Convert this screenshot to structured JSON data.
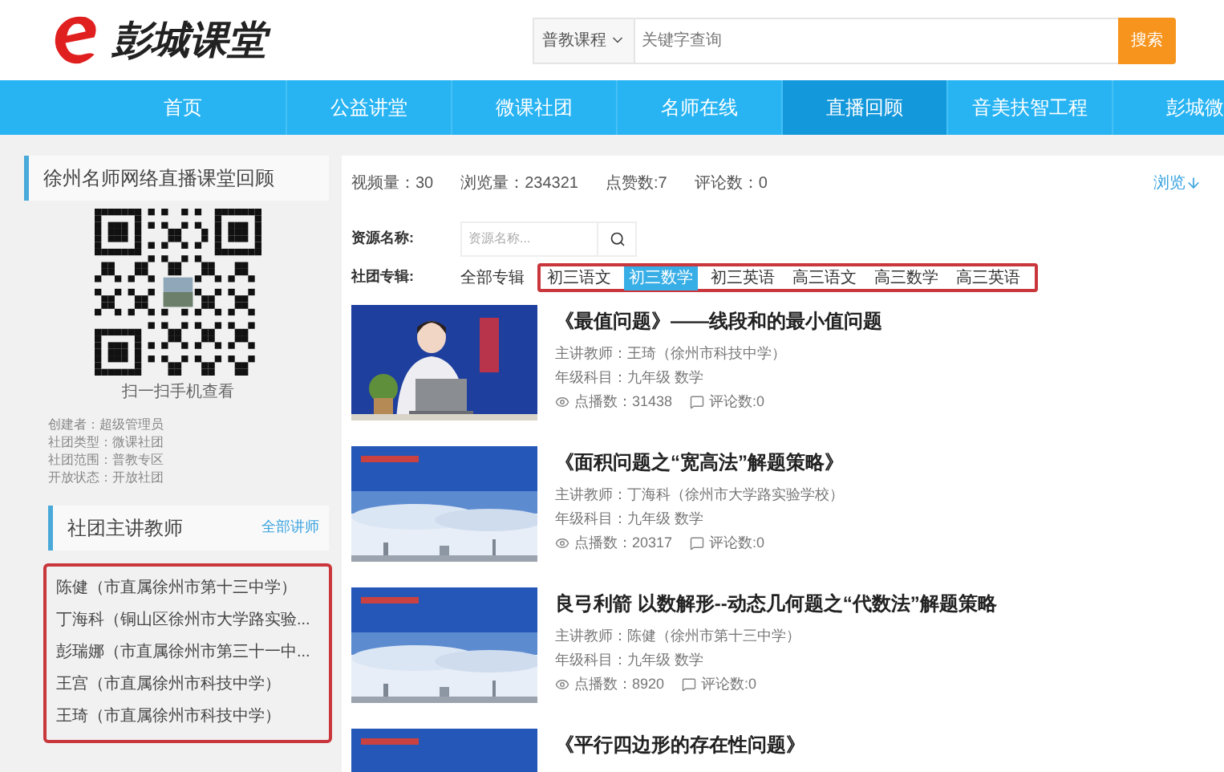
{
  "header": {
    "logo_text": "彭城课堂",
    "search": {
      "category": "普教课程",
      "placeholder": "关键字查询",
      "button": "搜索"
    }
  },
  "nav": [
    {
      "label": "首页",
      "selected": false
    },
    {
      "label": "公益讲堂",
      "selected": false
    },
    {
      "label": "微课社团",
      "selected": false
    },
    {
      "label": "名师在线",
      "selected": false
    },
    {
      "label": "直播回顾",
      "selected": true
    },
    {
      "label": "音美扶智工程",
      "selected": false
    },
    {
      "label": "彭城微",
      "selected": false
    }
  ],
  "sidebar": {
    "title": "徐州名师网络直播课堂回顾",
    "qr_caption": "扫一扫手机查看",
    "info": [
      "创建者：超级管理员",
      "社团类型：微课社团",
      "社团范围：普教专区",
      "开放状态：开放社团"
    ],
    "teachers_title": "社团主讲教师",
    "teachers_link": "全部讲师",
    "teachers": [
      "陈健（市直属徐州市第十三中学）",
      "丁海科（铜山区徐州市大学路实验...",
      "彭瑞娜（市直属徐州市第三十一中...",
      "王宫（市直属徐州市科技中学）",
      "王琦（市直属徐州市科技中学）"
    ]
  },
  "main": {
    "stats": [
      "视频量：30",
      "浏览量：234321",
      "点赞数:7",
      "评论数：0"
    ],
    "sort": "浏览",
    "search_label": "资源名称:",
    "search_placeholder": "资源名称...",
    "album_label": "社团专辑:",
    "all_albums": "全部专辑",
    "albums": [
      {
        "label": "初三语文",
        "selected": false
      },
      {
        "label": "初三数学",
        "selected": true
      },
      {
        "label": "初三英语",
        "selected": false
      },
      {
        "label": "高三语文",
        "selected": false
      },
      {
        "label": "高三数学",
        "selected": false
      },
      {
        "label": "高三英语",
        "selected": false
      }
    ],
    "videos": [
      {
        "kind": "presenter",
        "title": "《最值问题》——线段和的最小值问题",
        "teacher": "主讲教师：王琦（徐州市科技中学）",
        "grade": "年级科目：九年级 数学",
        "plays": "点播数：31438",
        "comments": "评论数:0"
      },
      {
        "kind": "slide",
        "title": "《面积问题之“宽高法”解题策略》",
        "teacher": "主讲教师：丁海科（徐州市大学路实验学校）",
        "grade": "年级科目：九年级 数学",
        "plays": "点播数：20317",
        "comments": "评论数:0"
      },
      {
        "kind": "slide",
        "title": "良弓利箭 以数解形--动态几何题之“代数法”解题策略",
        "teacher": "主讲教师：陈健（徐州市第十三中学）",
        "grade": "年级科目：九年级 数学",
        "plays": "点播数：8920",
        "comments": "评论数:0"
      },
      {
        "kind": "slide",
        "title": "《平行四边形的存在性问题》"
      }
    ]
  }
}
